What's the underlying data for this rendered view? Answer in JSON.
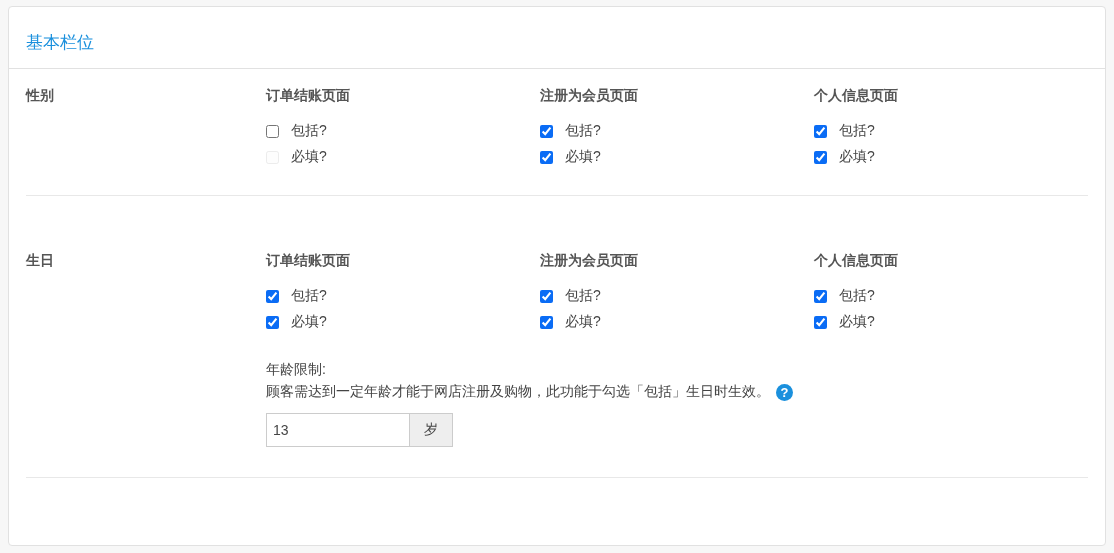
{
  "card": {
    "title": "基本栏位"
  },
  "fields": [
    {
      "label": "性别",
      "pages": [
        {
          "title": "订单结账页面",
          "options": [
            {
              "label": "包括?",
              "checked": false,
              "disabled": false
            },
            {
              "label": "必填?",
              "checked": false,
              "disabled": true
            }
          ]
        },
        {
          "title": "注册为会员页面",
          "options": [
            {
              "label": "包括?",
              "checked": true,
              "disabled": false
            },
            {
              "label": "必填?",
              "checked": true,
              "disabled": false
            }
          ]
        },
        {
          "title": "个人信息页面",
          "options": [
            {
              "label": "包括?",
              "checked": true,
              "disabled": false
            },
            {
              "label": "必填?",
              "checked": true,
              "disabled": false
            }
          ]
        }
      ]
    },
    {
      "label": "生日",
      "pages": [
        {
          "title": "订单结账页面",
          "options": [
            {
              "label": "包括?",
              "checked": true,
              "disabled": false
            },
            {
              "label": "必填?",
              "checked": true,
              "disabled": false
            }
          ]
        },
        {
          "title": "注册为会员页面",
          "options": [
            {
              "label": "包括?",
              "checked": true,
              "disabled": false
            },
            {
              "label": "必填?",
              "checked": true,
              "disabled": false
            }
          ]
        },
        {
          "title": "个人信息页面",
          "options": [
            {
              "label": "包括?",
              "checked": true,
              "disabled": false
            },
            {
              "label": "必填?",
              "checked": true,
              "disabled": false
            }
          ]
        }
      ],
      "age_limit": {
        "label": "年龄限制:",
        "description": "顾客需达到一定年龄才能于网店注册及购物，此功能于勾选「包括」生日时生效。",
        "help_mark": "?",
        "value": "13",
        "unit": "岁"
      }
    }
  ]
}
